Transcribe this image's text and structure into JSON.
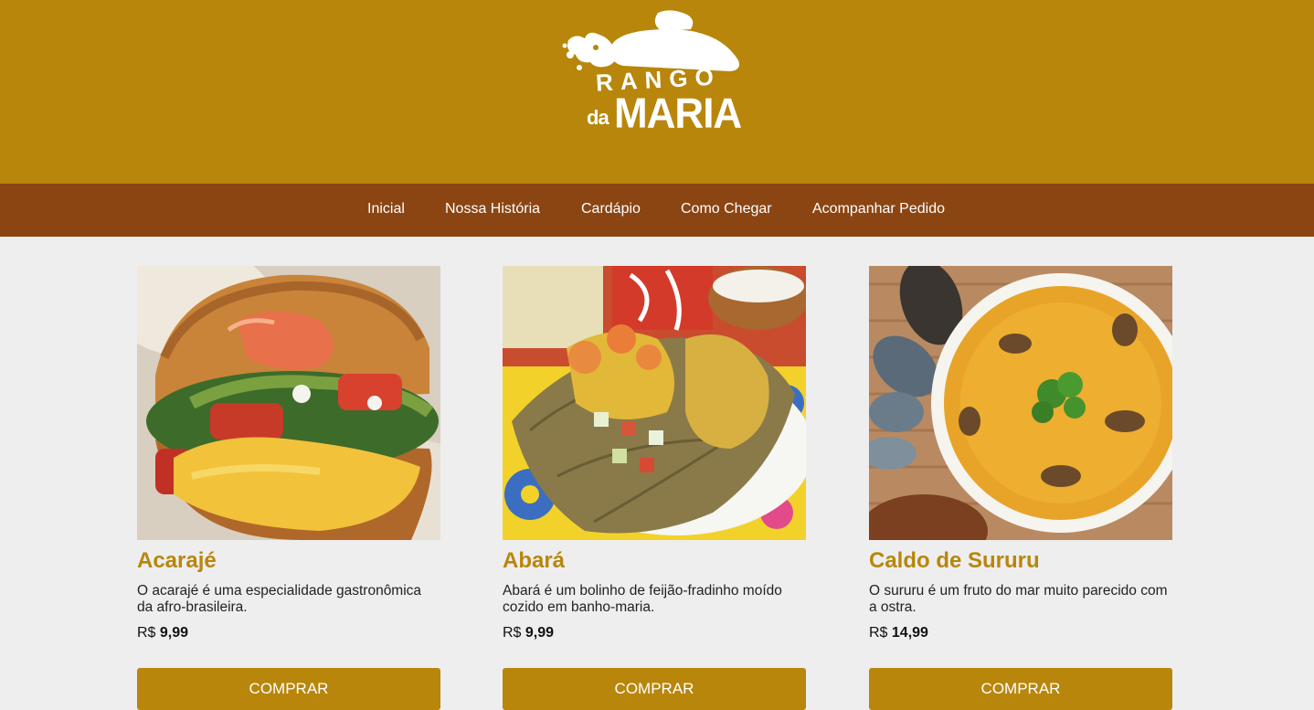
{
  "brand": {
    "logo_line1": "RANGO",
    "logo_da": "da",
    "logo_line2": "MARIA",
    "header_color": "#b8860b",
    "nav_color": "#8b4513",
    "page_bg": "#eeeeee"
  },
  "nav": {
    "items": [
      {
        "label": "Inicial"
      },
      {
        "label": "Nossa História"
      },
      {
        "label": "Cardápio"
      },
      {
        "label": "Como Chegar"
      },
      {
        "label": "Acompanhar Pedido"
      }
    ]
  },
  "products": [
    {
      "title": "Acarajé",
      "description": "O acarajé é uma especialidade gastronômica da afro-brasileira.",
      "currency": "R$",
      "price": "9,99",
      "button": "COMPRAR",
      "image_icon": "acaraje-photo"
    },
    {
      "title": "Abará",
      "description": "Abará é um bolinho de feijão-fradinho moído cozido em banho-maria.",
      "currency": "R$",
      "price": "9,99",
      "button": "COMPRAR",
      "image_icon": "abara-photo"
    },
    {
      "title": "Caldo de Sururu",
      "description": "O sururu é um fruto do mar muito parecido com a ostra.",
      "currency": "R$",
      "price": "14,99",
      "button": "COMPRAR",
      "image_icon": "caldo-de-sururu-photo"
    }
  ]
}
